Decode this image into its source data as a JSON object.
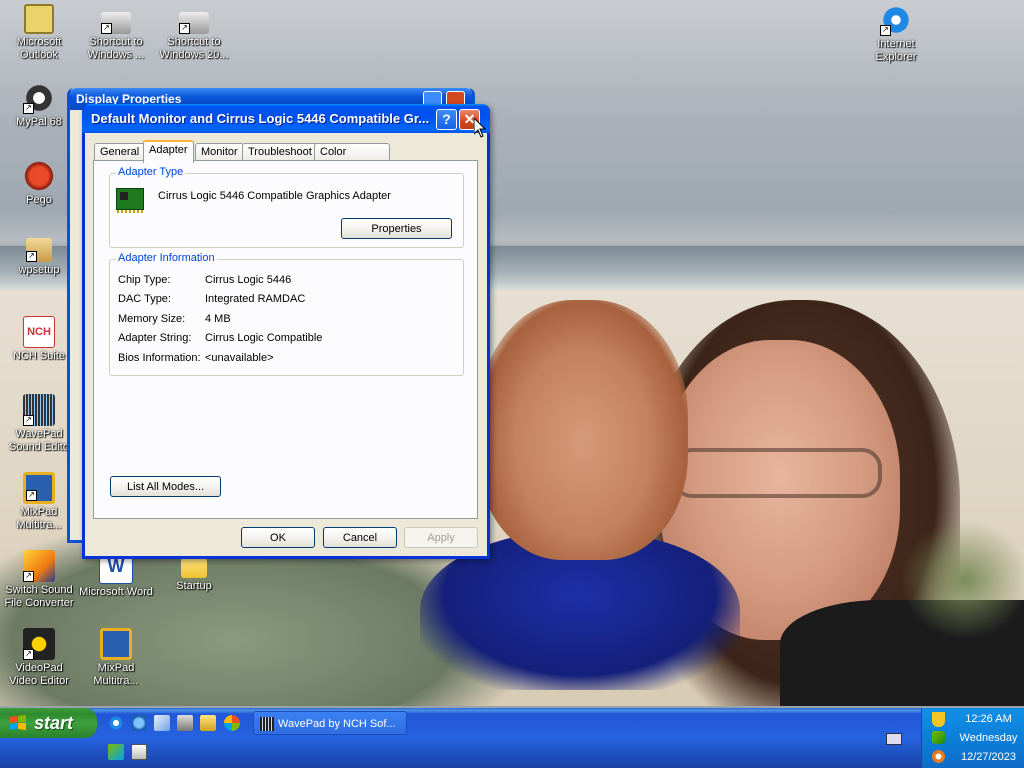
{
  "desktop": {
    "icons": [
      {
        "label": "Microsoft Outlook",
        "name": "outlook-icon"
      },
      {
        "label": "Shortcut to Windows ...",
        "name": "shortcut-windows-icon"
      },
      {
        "label": "Shortcut to Windows 20...",
        "name": "shortcut-windows-20-icon"
      },
      {
        "label": "Internet Explorer",
        "name": "internet-explorer-icon"
      },
      {
        "label": "MyPal 68",
        "name": "mypal-icon"
      },
      {
        "label": "Pego",
        "name": "pego-icon"
      },
      {
        "label": "wpsetup",
        "name": "wpsetup-icon"
      },
      {
        "label": "NCH Suite",
        "name": "nch-suite-icon"
      },
      {
        "label": "WavePad Sound Edito",
        "name": "wavepad-icon"
      },
      {
        "label": "MixPad Multitra...",
        "name": "mixpad-icon"
      },
      {
        "label": "Switch Sound File Converter",
        "name": "switch-icon"
      },
      {
        "label": "Microsoft Word",
        "name": "word-icon"
      },
      {
        "label": "Startup",
        "name": "startup-folder-icon"
      },
      {
        "label": "VideoPad Video Editor",
        "name": "videopad-icon"
      },
      {
        "label": "MixPad Multitra...",
        "name": "mixpad-2-icon"
      }
    ]
  },
  "background_dialog": {
    "title": "Display Properties"
  },
  "dialog": {
    "title": "Default Monitor and Cirrus Logic 5446 Compatible Gr...",
    "help_label": "?",
    "close_label": "✕",
    "tabs": [
      "General",
      "Adapter",
      "Monitor",
      "Troubleshoot",
      "Color Management"
    ],
    "active_tab": "Adapter",
    "adapter_type": {
      "legend": "Adapter Type",
      "name": "Cirrus Logic 5446 Compatible Graphics Adapter",
      "properties_label": "Properties"
    },
    "adapter_info": {
      "legend": "Adapter Information",
      "rows": [
        {
          "label": "Chip Type:",
          "value": "Cirrus Logic 5446"
        },
        {
          "label": "DAC Type:",
          "value": "Integrated RAMDAC"
        },
        {
          "label": "Memory Size:",
          "value": "4 MB"
        },
        {
          "label": "Adapter String:",
          "value": "Cirrus Logic Compatible"
        },
        {
          "label": "Bios Information:",
          "value": "<unavailable>"
        }
      ]
    },
    "list_modes_label": "List All Modes...",
    "ok_label": "OK",
    "cancel_label": "Cancel",
    "apply_label": "Apply"
  },
  "taskbar": {
    "start_label": "start",
    "task_button": "WavePad by NCH Sof...",
    "clock_time": "12:26 AM",
    "clock_day": "Wednesday",
    "clock_date": "12/27/2023"
  },
  "colors": {
    "title_blue": "#0053ee",
    "close_red": "#d2481f",
    "start_green": "#2f8a2f",
    "legend_blue": "#0046d5"
  }
}
